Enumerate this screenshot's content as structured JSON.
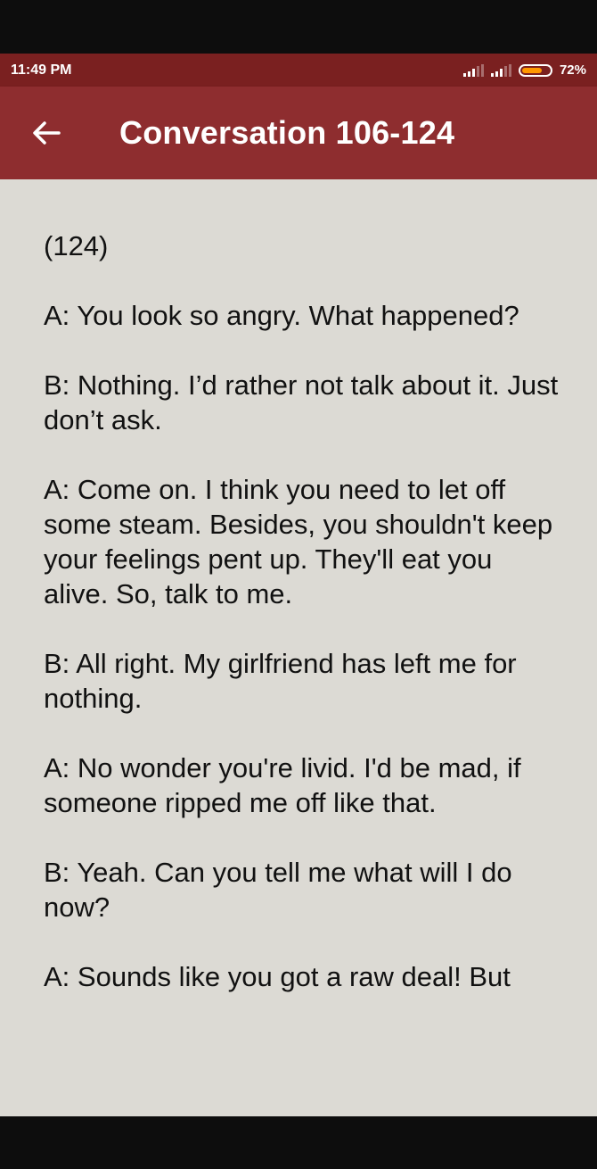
{
  "status_bar": {
    "time": "11:49 PM",
    "battery_percent": "72%",
    "battery_level": 0.72,
    "battery_color": "#ff9800"
  },
  "app_bar": {
    "back_icon": "arrow-left-icon",
    "title": "Conversation 106-124",
    "color": "#8e2d2f"
  },
  "content": {
    "paragraphs": [
      "(124)",
      "A: You look so angry. What happened?",
      "B: Nothing. I’d rather not talk about it. Just don’t ask.",
      "A: Come on. I think you need to let off some steam. Besides, you shouldn't keep your feelings pent up. They'll eat you alive. So, talk to me.",
      "B: All right. My girlfriend has left me for nothing.",
      "A: No wonder you're livid. I'd be mad, if someone ripped me off like that.",
      "B: Yeah. Can you tell me what will I do now?",
      "A: Sounds like you got a raw deal! But"
    ]
  }
}
